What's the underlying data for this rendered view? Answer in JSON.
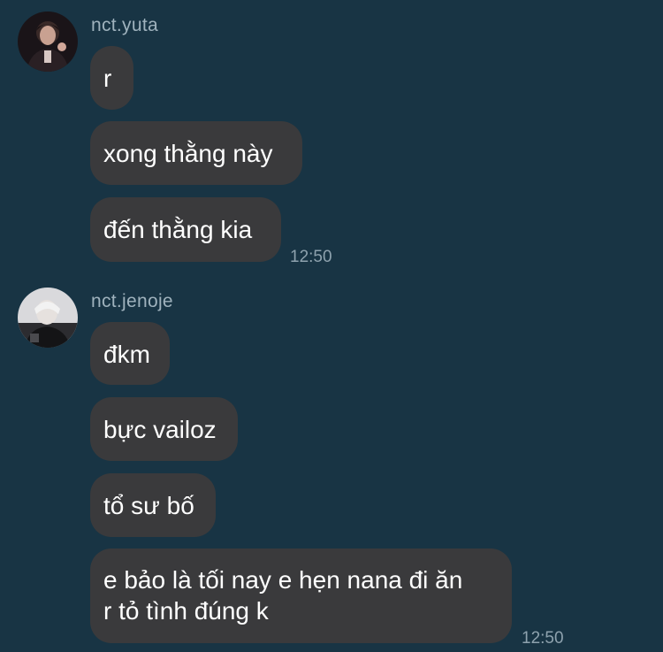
{
  "chat": {
    "groups": [
      {
        "sender": "nct.yuta",
        "avatar": "profile-photo",
        "messages": [
          "r",
          "xong thằng này",
          "đến thằng kia"
        ],
        "time": "12:50"
      },
      {
        "sender": "nct.jenoje",
        "avatar": "profile-photo",
        "messages": [
          "đkm",
          "bực vailoz",
          "tổ sư bố",
          "e bảo là tối nay e hẹn nana đi ăn\nr tỏ tình đúng k"
        ],
        "time": "12:50"
      }
    ]
  },
  "colors": {
    "background": "#183444",
    "bubble": "#3a3a3c",
    "text": "#ffffff",
    "meta": "#8ea2ae"
  }
}
